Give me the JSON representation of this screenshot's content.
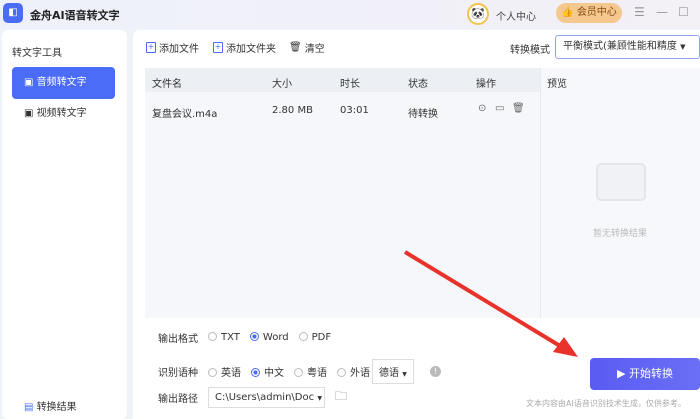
{
  "app": {
    "title": "金舟AI语音转文字",
    "personal_center": "个人中心",
    "vip_center": "会员中心"
  },
  "sidebar": {
    "title": "转文字工具",
    "items": [
      {
        "label": "音频转文字"
      },
      {
        "label": "视频转文字"
      }
    ],
    "result": "转换结果"
  },
  "toolbar": {
    "add_file": "添加文件",
    "add_folder": "添加文件夹",
    "clear": "清空",
    "mode_label": "转换模式",
    "mode_value": "平衡模式(兼顾性能和精度"
  },
  "table": {
    "headers": [
      "文件名",
      "大小",
      "时长",
      "状态",
      "操作"
    ],
    "rows": [
      {
        "name": "复盘会议.m4a",
        "size": "2.80 MB",
        "duration": "03:01",
        "status": "待转换"
      }
    ]
  },
  "preview": {
    "title": "预览",
    "empty": "暂无转换结果"
  },
  "options": {
    "format_label": "输出格式",
    "formats": [
      "TXT",
      "Word",
      "PDF"
    ],
    "format_selected": "Word",
    "lang_label": "识别语种",
    "langs": [
      "英语",
      "中文",
      "粤语",
      "外语"
    ],
    "lang_selected": "中文",
    "foreign_value": "德语",
    "path_label": "输出路径",
    "path_value": "C:\\Users\\admin\\Doc"
  },
  "start_button": "开始转换",
  "disclaimer": "文本内容由AI语音识别技术生成，仅供参考。"
}
